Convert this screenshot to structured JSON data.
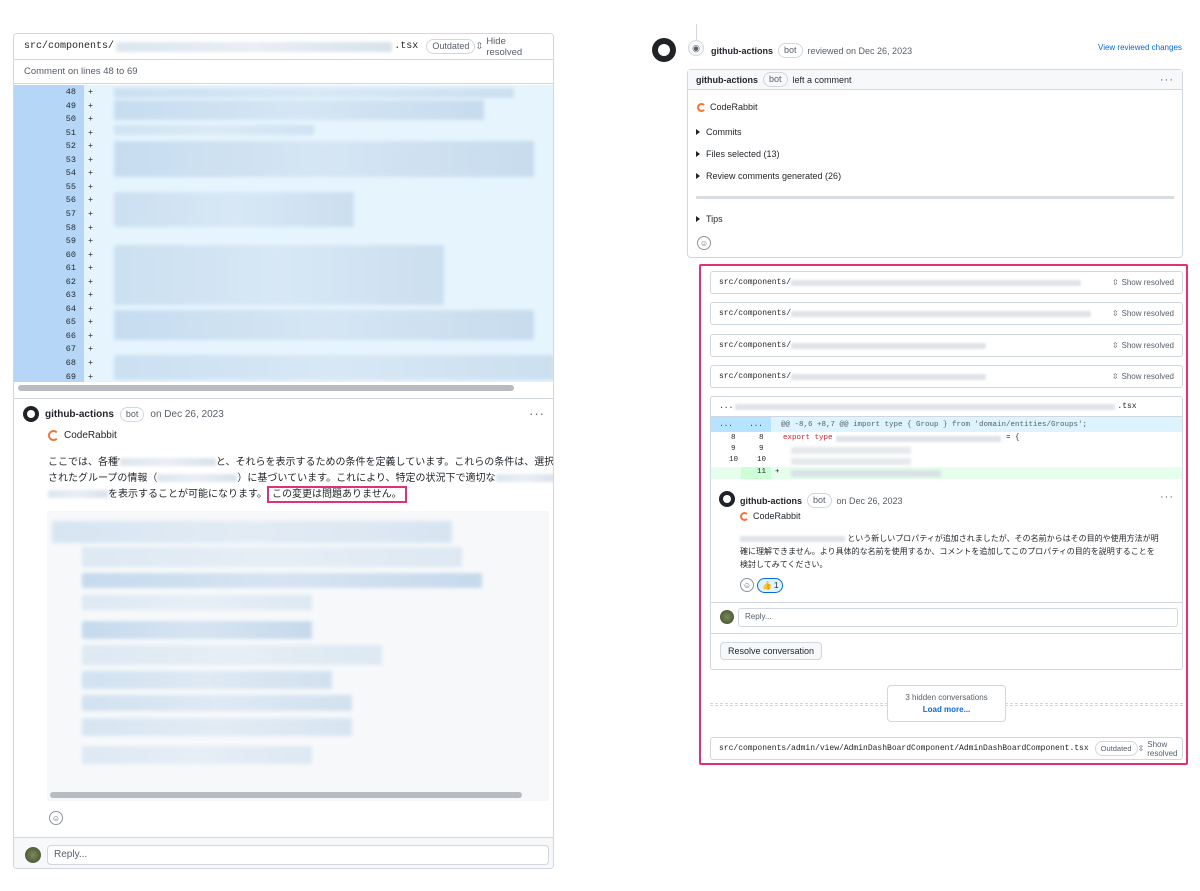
{
  "left_panel": {
    "file_path": "src/components/",
    "file_ext": ".tsx",
    "outdated_badge": "Outdated",
    "hide_resolved": "Hide resolved",
    "comment_on": "Comment on lines 48 to 69",
    "line_numbers": [
      "48",
      "49",
      "50",
      "51",
      "52",
      "53",
      "54",
      "55",
      "56",
      "57",
      "58",
      "59",
      "60",
      "61",
      "62",
      "63",
      "64",
      "65",
      "66",
      "67",
      "68",
      "69"
    ],
    "diff_marker": "+",
    "comment": {
      "author": "github-actions",
      "bot_badge": "bot",
      "date": "on Dec 26, 2023",
      "app_name": "CodeRabbit",
      "line1_start": "ここでは、各種'",
      "line1_end": "と、それらを表示するための条件を定義しています。これらの条件は、選択",
      "line2_start": "されたグループの情報（",
      "line2_end": "）に基づいています。これにより、特定の状況下で適切な",
      "line3_end": "を表示することが可能になります。",
      "highlight": "この変更は問題ありません。"
    },
    "reply_placeholder": "Reply..."
  },
  "right_panel": {
    "review_author": "github-actions",
    "bot_badge": "bot",
    "review_text": "reviewed on Dec 26, 2023",
    "view_changes": "View reviewed changes",
    "summary_author": "github-actions",
    "summary_text": "left a comment",
    "app_name": "CodeRabbit",
    "items": [
      "Commits",
      "Files selected (13)",
      "Review comments generated (26)",
      "Tips"
    ],
    "files": [
      {
        "path": "src/components/",
        "action": "Show resolved"
      },
      {
        "path": "src/components/",
        "action": "Show resolved"
      },
      {
        "path": "src/components/",
        "action": "Show resolved"
      },
      {
        "path": "src/components/",
        "action": "Show resolved"
      }
    ],
    "diff": {
      "file_prefix": "...",
      "file_ext": ".tsx",
      "hunk_dots": "...",
      "hunk_text": "@@ -8,6 +8,7 @@ import type { Group } from 'domain/entities/Groups';",
      "rows": [
        {
          "old": "8",
          "new": "8",
          "code": "export type",
          "tail": "= {"
        },
        {
          "old": "9",
          "new": "9",
          "code": "",
          "tail": ""
        },
        {
          "old": "10",
          "new": "10",
          "code": "",
          "tail": ""
        },
        {
          "old": "",
          "new": "11",
          "code": "+",
          "tail": ""
        }
      ]
    },
    "inline_comment": {
      "author": "github-actions",
      "bot_badge": "bot",
      "date": "on Dec 26, 2023",
      "app_name": "CodeRabbit",
      "body_line1": "という新しいプロパティが追加されましたが、その名前からはその目的や使用方法が明",
      "body_line2": "確に理解できません。より具体的な名前を使用するか、コメントを追加してこのプロパティの目的を説明することを",
      "body_line3": "検討してみてください。",
      "reaction": "1",
      "reply_placeholder": "Reply...",
      "resolve_button": "Resolve conversation"
    },
    "hidden": {
      "count_text": "3 hidden conversations",
      "load_more": "Load more..."
    },
    "last_file": {
      "path": "src/components/admin/view/AdminDashBoardComponent/AdminDashBoardComponent.tsx",
      "badge": "Outdated",
      "action": "Show resolved"
    }
  },
  "colors": {
    "highlight_border": "#e0307a",
    "link": "#0969da",
    "diff_added_bg": "#e6f4fd",
    "diff_gutter": "#b5d6f6"
  }
}
